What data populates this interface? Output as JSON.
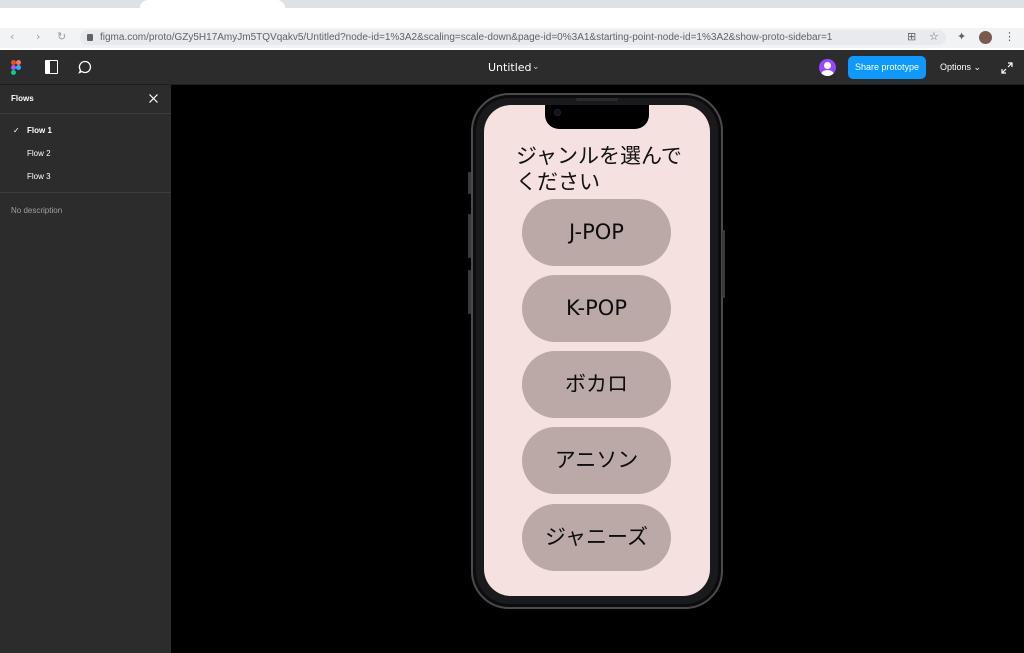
{
  "browser": {
    "url": "figma.com/proto/GZy5H17AmyJm5TQVqakv5/Untitled?node-id=1%3A2&scaling=scale-down&page-id=0%3A1&starting-point-node-id=1%3A2&show-proto-sidebar=1"
  },
  "toolbar": {
    "doc_title": "Untitled",
    "share_label": "Share prototype",
    "options_label": "Options",
    "accent_color": "#0d99ff"
  },
  "sidebar": {
    "title": "Flows",
    "flows": [
      {
        "label": "Flow 1",
        "active": true
      },
      {
        "label": "Flow 2",
        "active": false
      },
      {
        "label": "Flow 3",
        "active": false
      }
    ],
    "description": "No description"
  },
  "prototype": {
    "prompt": "ジャンルを選んでください",
    "genres": [
      "J-POP",
      "K-POP",
      "ボカロ",
      "アニソン",
      "ジャニーズ"
    ],
    "screen_color": "#f5e1df",
    "button_color": "#bba9a7"
  }
}
